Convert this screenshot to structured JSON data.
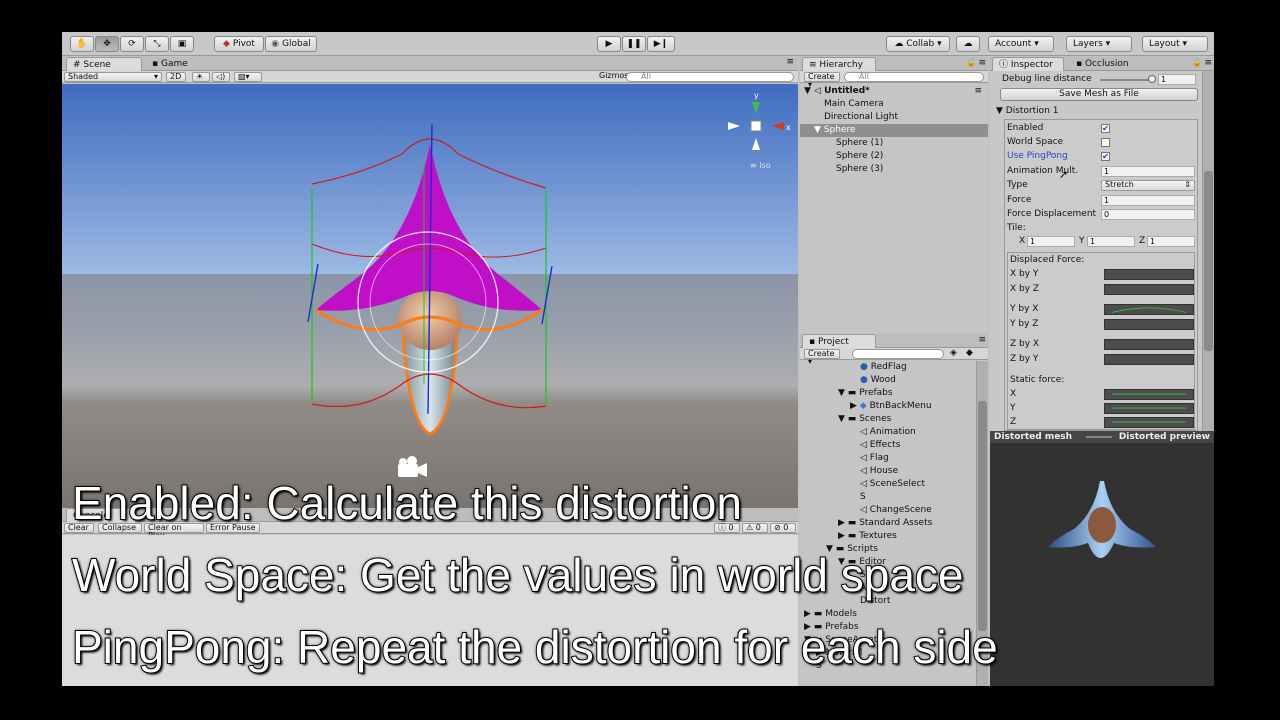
{
  "toolbar": {
    "pivot": "Pivot",
    "global": "Global",
    "collab": "Collab",
    "account": "Account",
    "layers": "Layers",
    "layout": "Layout"
  },
  "scene": {
    "tabs": [
      "Scene",
      "Game"
    ],
    "shading": "Shaded",
    "mode_2d": "2D",
    "gizmos": "Gizmos",
    "search_placeholder": "All",
    "gizmo_y": "y",
    "gizmo_x": "x",
    "iso": "Iso"
  },
  "console": {
    "tab": "Console",
    "buttons": [
      "Clear",
      "Collapse",
      "Clear on Play",
      "Error Pause"
    ],
    "counts": [
      "0",
      "0",
      "0"
    ]
  },
  "hierarchy": {
    "tab": "Hierarchy",
    "create": "Create",
    "search_placeholder": "All",
    "items": [
      {
        "label": "Untitled*"
      },
      {
        "label": "Main Camera"
      },
      {
        "label": "Directional Light"
      },
      {
        "label": "Sphere"
      },
      {
        "label": "Sphere (1)"
      },
      {
        "label": "Sphere (2)"
      },
      {
        "label": "Sphere (3)"
      }
    ]
  },
  "project": {
    "tab": "Project",
    "create": "Create",
    "items": [
      {
        "label": "RedFlag"
      },
      {
        "label": "Wood"
      },
      {
        "label": "Prefabs"
      },
      {
        "label": "BtnBackMenu"
      },
      {
        "label": "Scenes"
      },
      {
        "label": "Animation"
      },
      {
        "label": "Effects"
      },
      {
        "label": "Flag"
      },
      {
        "label": "House"
      },
      {
        "label": "SceneSelect"
      },
      {
        "label": "S"
      },
      {
        "label": "ChangeScene"
      },
      {
        "label": "Standard Assets"
      },
      {
        "label": "Textures"
      },
      {
        "label": "Scripts"
      },
      {
        "label": "Editor"
      },
      {
        "label": "S"
      },
      {
        "label": "A"
      },
      {
        "label": "Distort"
      },
      {
        "label": "Models"
      },
      {
        "label": "Prefabs"
      },
      {
        "label": "SceneAssets"
      },
      {
        "label": "Material"
      },
      {
        "label": "S"
      }
    ]
  },
  "inspector": {
    "tabs": [
      "Inspector",
      "Occlusion"
    ],
    "debug_line_distance": "Debug line distance",
    "debug_value": "1",
    "save_mesh": "Save Mesh as File",
    "section": "Distortion 1",
    "enabled": "Enabled",
    "world_space": "World Space",
    "use_pingpong": "Use PingPong",
    "animation_mult": "Animation Mult.",
    "animation_mult_value": "1",
    "type": "Type",
    "type_value": "Stretch",
    "force": "Force",
    "force_value": "1",
    "force_displacement": "Force Displacement",
    "force_displacement_value": "0",
    "tile": "Tile:",
    "tile_x_label": "X",
    "tile_x": "1",
    "tile_y_label": "Y",
    "tile_y": "1",
    "tile_z_label": "Z",
    "tile_z": "1",
    "displaced_force": "Displaced Force:",
    "curves": [
      "X by Y",
      "X by Z",
      "Y by X",
      "Y by Z",
      "Z by X",
      "Z by Y"
    ],
    "static_force": "Static force:",
    "static_rows": [
      "X",
      "Y",
      "Z"
    ],
    "checks": {
      "enabled": true,
      "world_space": false,
      "use_pingpong": true
    }
  },
  "preview": {
    "left": "Distorted mesh",
    "right": "Distorted preview"
  },
  "subtitles": [
    "Enabled: Calculate this distortion",
    "World Space: Get the values in world space",
    "PingPong: Repeat the distortion for each side"
  ]
}
